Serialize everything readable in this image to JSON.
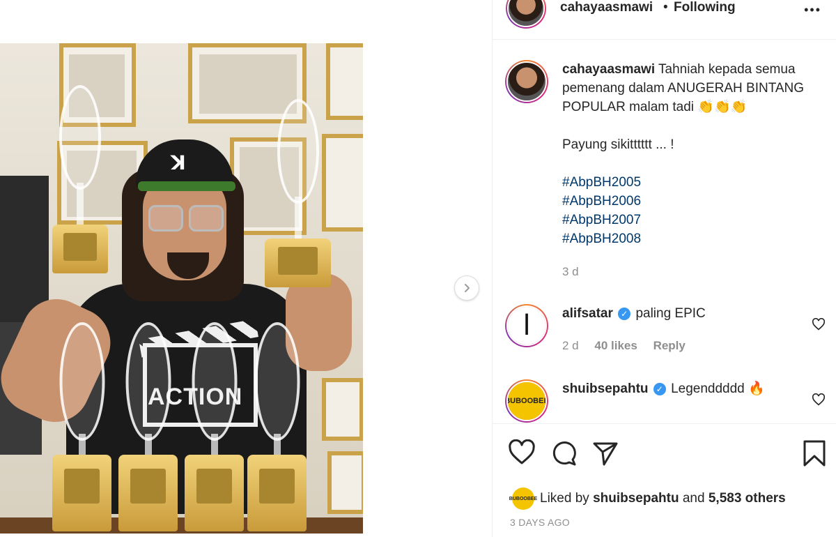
{
  "header": {
    "username": "cahayaasmawi",
    "separator": "•",
    "follow_status": "Following",
    "more": "•••"
  },
  "caption": {
    "username": "cahayaasmawi",
    "text": "Tahniah kepada semua pemenang dalam ANUGERAH BINTANG POPULAR malam tadi 👏👏👏",
    "line2": "Payung sikitttttt ... !",
    "hashtags": [
      "#AbpBH2005",
      "#AbpBH2006",
      "#AbpBH2007",
      "#AbpBH2008"
    ],
    "time": "3 d"
  },
  "comments": [
    {
      "username": "alifsatar",
      "verified": true,
      "text": "paling EPIC",
      "time": "2 d",
      "likes": "40 likes",
      "reply": "Reply",
      "avatar_glyph": "ا"
    },
    {
      "username": "shuibsepahtu",
      "verified": true,
      "text": "Legenddddd 🔥",
      "avatar_glyph": "BUBOOBEE"
    }
  ],
  "likes": {
    "prefix": "Liked by",
    "user": "shuibsepahtu",
    "and": "and",
    "others": "5,583 others"
  },
  "timestamp": "3 DAYS AGO",
  "photo": {
    "cap_logo": "ꓘ",
    "shirt_text": "ACTION"
  },
  "icons": {
    "heart": "heart-icon",
    "comment": "comment-icon",
    "share": "share-icon",
    "save": "bookmark-icon",
    "next": "chevron-right-icon"
  }
}
